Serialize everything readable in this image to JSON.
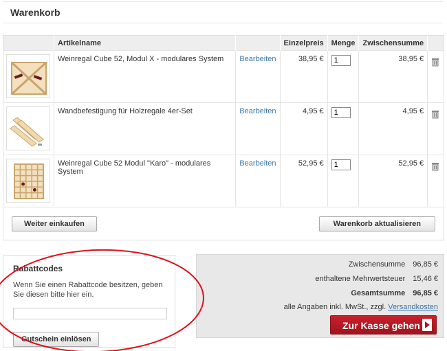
{
  "page": {
    "title": "Warenkorb"
  },
  "table": {
    "headers": {
      "article": "Artikelname",
      "unit_price": "Einzelpreis",
      "quantity": "Menge",
      "subtotal": "Zwischensumme"
    },
    "edit_label": "Bearbeiten",
    "items": [
      {
        "name": "Weinregal Cube 52, Modul X - modulares System",
        "unit_price": "38,95 €",
        "quantity": "1",
        "subtotal": "38,95 €"
      },
      {
        "name": "Wandbefestigung für Holzregale 4er-Set",
        "unit_price": "4,95 €",
        "quantity": "1",
        "subtotal": "4,95 €"
      },
      {
        "name": "Weinregal Cube 52 Modul \"Karo\" - modulares System",
        "unit_price": "52,95 €",
        "quantity": "1",
        "subtotal": "52,95 €"
      }
    ]
  },
  "buttons": {
    "continue_shopping": "Weiter einkaufen",
    "update_cart": "Warenkorb aktualisieren",
    "redeem_coupon": "Gutschein einlösen",
    "checkout": "Zur Kasse gehen"
  },
  "coupon": {
    "title": "Rabattcodes",
    "text": "Wenn Sie einen Rabattcode besitzen, geben Sie diesen bitte hier ein.",
    "value": ""
  },
  "totals": {
    "subtotal_label": "Zwischensumme",
    "subtotal_value": "96,85 €",
    "vat_label": "enthaltene Mehrwertsteuer",
    "vat_value": "15,46 €",
    "total_label": "Gesamtsumme",
    "total_value": "96,85 €",
    "note_prefix": "alle Angaben inkl. MwSt., zzgl.",
    "shipping_link": "Versandkosten"
  },
  "colors": {
    "accent_red": "#b0161f",
    "link_blue": "#3c76a8",
    "annotation_red": "#e0101a"
  }
}
